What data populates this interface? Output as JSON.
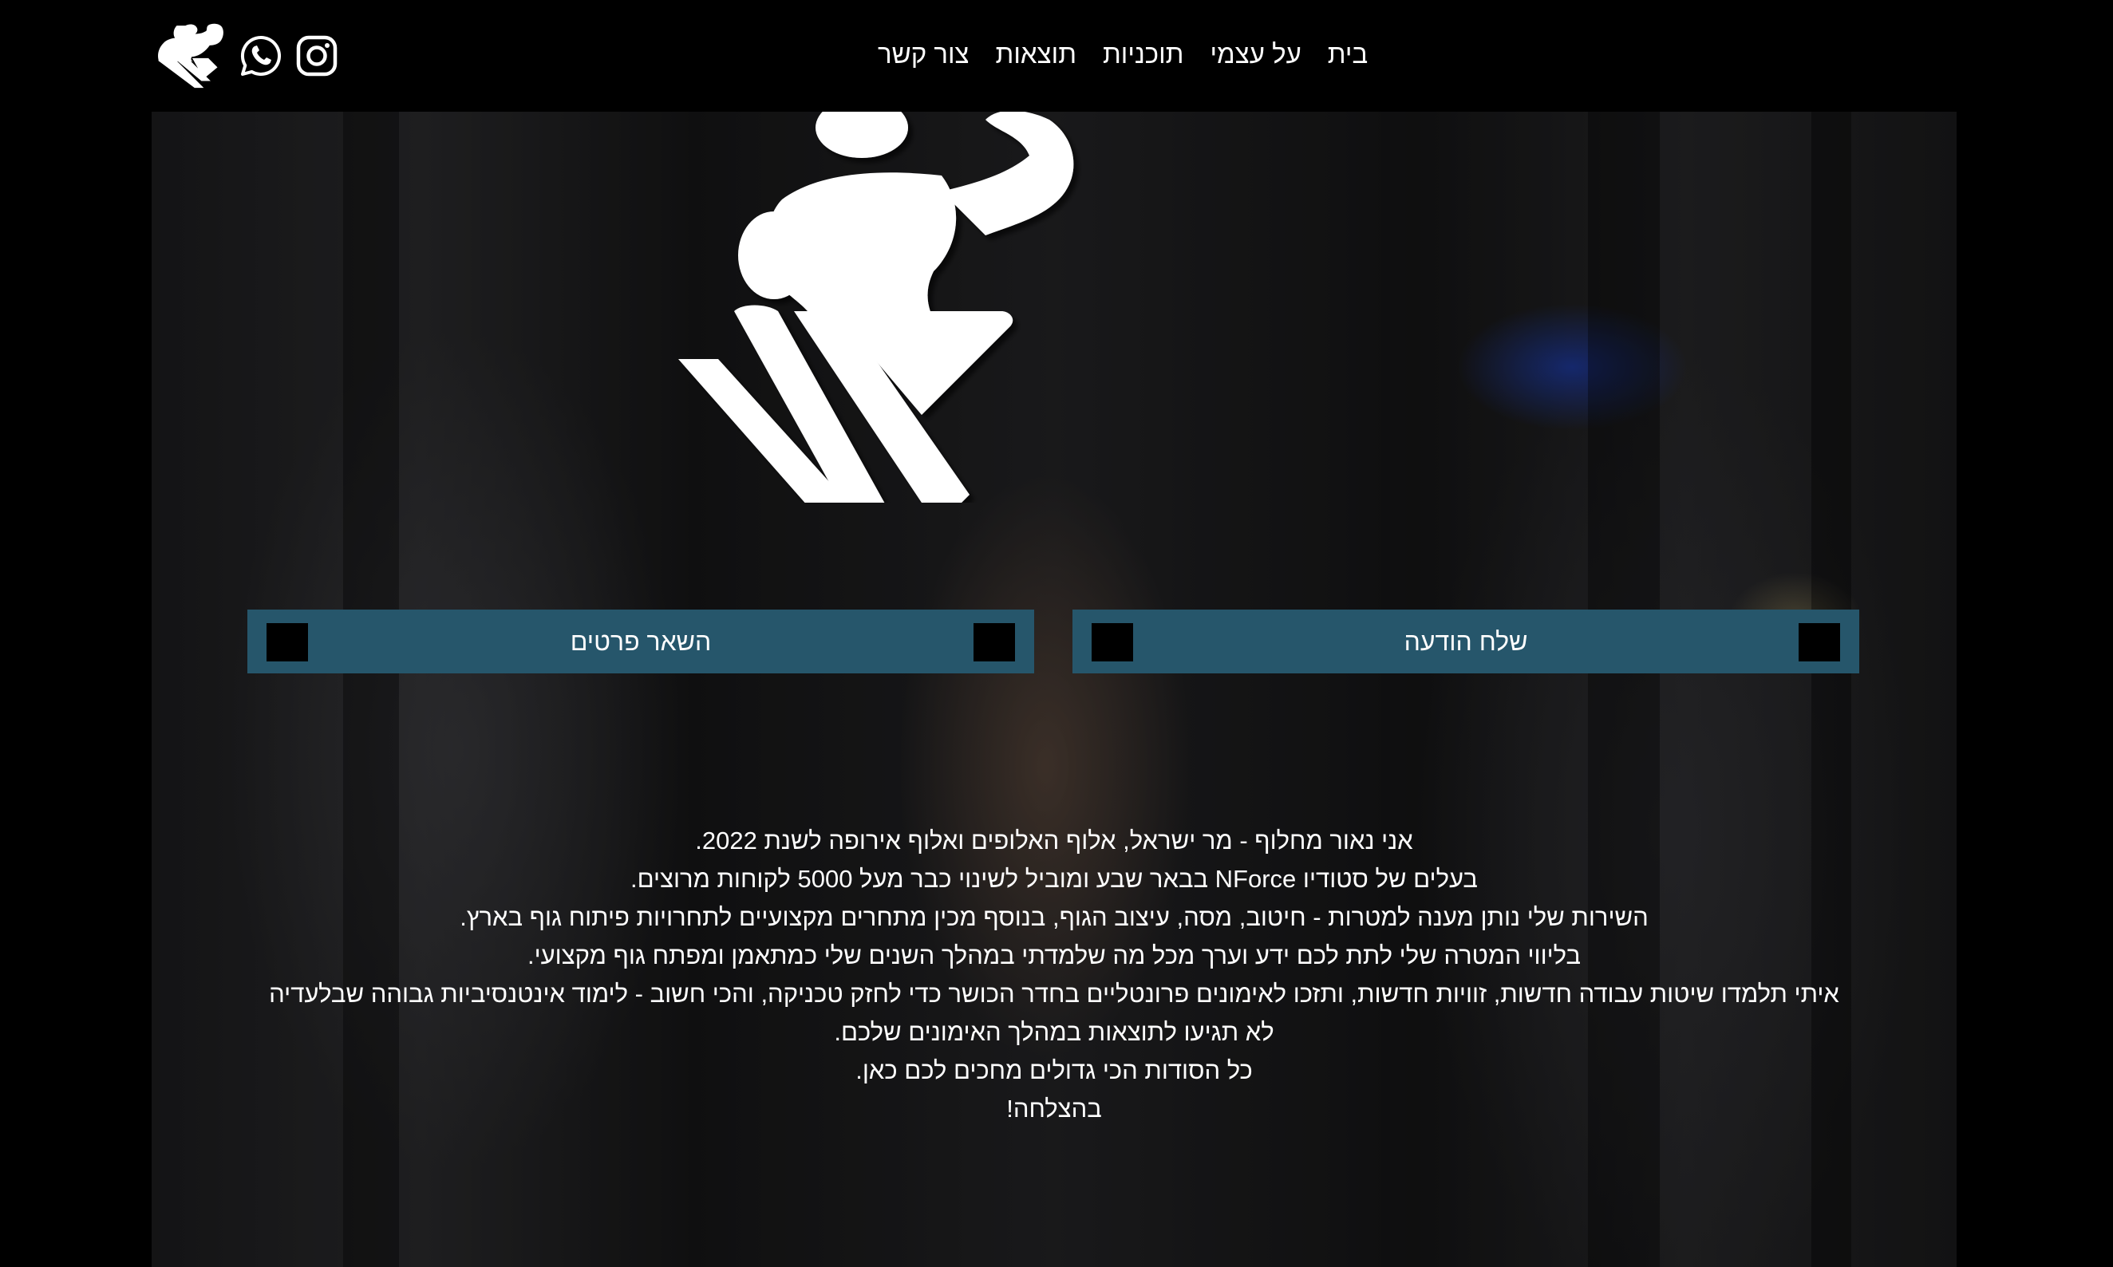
{
  "header": {
    "nav": [
      {
        "label": "צור קשר"
      },
      {
        "label": "תוצאות"
      },
      {
        "label": "תוכניות"
      },
      {
        "label": "על עצמי"
      },
      {
        "label": "בית"
      }
    ],
    "icons": [
      "brand-logo-icon",
      "whatsapp-icon",
      "instagram-icon"
    ]
  },
  "hero": {
    "logo": "bodybuilder-logo-icon",
    "buttons": {
      "send_message": "שלח הודעה",
      "leave_details": "השאר פרטים"
    }
  },
  "about": {
    "lines": [
      "אני נאור מחלוף - מר ישראל, אלוף האלופים ואלוף אירופה לשנת 2022.",
      "בעלים של סטודיו NForce בבאר שבע ומוביל לשינוי כבר מעל 5000 לקוחות מרוצים.",
      "השירות שלי נותן מענה למטרות - חיטוב, מסה, עיצוב הגוף, בנוסף מכין מתחרים מקצועיים לתחרויות פיתוח גוף בארץ.",
      "בליווי המטרה שלי לתת לכם ידע וערך מכל מה שלמדתי במהלך השנים שלי כמתאמן ומפתח גוף מקצועי.",
      "איתי תלמדו שיטות עבודה חדשות, זוויות חדשות, ותזכו לאימונים פרונטליים בחדר הכושר כדי לחזק טכניקה, והכי חשוב - לימוד אינטנסיביות גבוהה שבלעדיה",
      "לא תגיעו לתוצאות במהלך האימונים שלכם.",
      "כל הסודות הכי גדולים מחכים לכם כאן.",
      "בהצלחה!"
    ]
  },
  "colors": {
    "background": "#000000",
    "button_bg": "#26566b",
    "text": "#ffffff"
  }
}
